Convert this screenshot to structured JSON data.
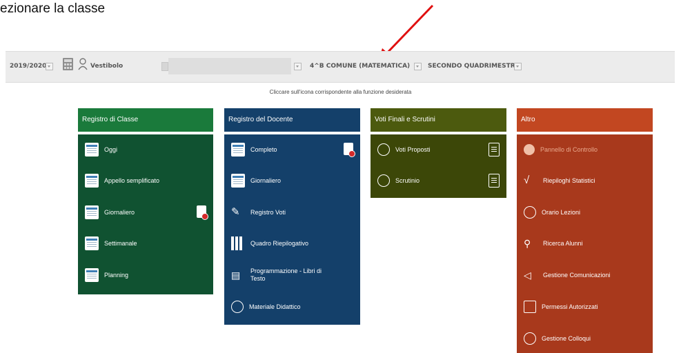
{
  "caption": "ezionare la classe",
  "topbar": {
    "year": "2019/2020",
    "user_label": "Vestibolo",
    "class_selector": "4^B COMUNE (MATEMATICA)",
    "period_selector": "SECONDO QUADRIMESTRE"
  },
  "instruction": "Cliccare sull'icona corrispondente alla funzione desiderata",
  "colors": {
    "registro_classe": "#1a7a3b",
    "registro_classe_body": "#105231",
    "registro_docente": "#14406a",
    "voti_finali": "#4c5a0e",
    "voti_finali_body": "#3c4708",
    "altro": "#c24721",
    "altro_body": "#a8391c",
    "arrow": "#e01010"
  },
  "panels": {
    "registro_classe": {
      "title": "Registro di Classe",
      "items": [
        {
          "label": "Oggi",
          "icon": "calendar-day-icon"
        },
        {
          "label": "Appello semplificato",
          "icon": "checklist-icon"
        },
        {
          "label": "Giornaliero",
          "icon": "calendar-icon"
        },
        {
          "label": "Settimanale",
          "icon": "calendar-week-icon"
        },
        {
          "label": "Planning",
          "icon": "planning-icon"
        }
      ]
    },
    "registro_docente": {
      "title": "Registro del Docente",
      "items": [
        {
          "label": "Completo",
          "icon": "register-icon"
        },
        {
          "label": "Giornaliero",
          "icon": "calendar-icon"
        },
        {
          "label": "Registro Voti",
          "icon": "grades-icon"
        },
        {
          "label": "Quadro Riepilogativo",
          "icon": "bar-chart-icon"
        },
        {
          "label": "Programmazione - Libri di Testo",
          "icon": "books-icon"
        },
        {
          "label": "Materiale Didattico",
          "icon": "material-icon"
        }
      ]
    },
    "voti_finali": {
      "title": "Voti Finali e Scrutini",
      "items": [
        {
          "label": "Voti Proposti",
          "icon": "user-icon"
        },
        {
          "label": "Scrutinio",
          "icon": "users-icon"
        }
      ]
    },
    "altro": {
      "title": "Altro",
      "items": [
        {
          "label": "Pannello di Controllo",
          "icon": "gear-icon",
          "disabled": true
        },
        {
          "label": "Riepiloghi Statistici",
          "icon": "statistics-icon"
        },
        {
          "label": "Orario Lezioni",
          "icon": "clock-icon"
        },
        {
          "label": "Ricerca Alunni",
          "icon": "search-user-icon"
        },
        {
          "label": "Gestione Comunicazioni",
          "icon": "megaphone-icon"
        },
        {
          "label": "Permessi Autorizzati",
          "icon": "permission-icon"
        },
        {
          "label": "Gestione Colloqui",
          "icon": "meeting-icon"
        }
      ]
    }
  }
}
